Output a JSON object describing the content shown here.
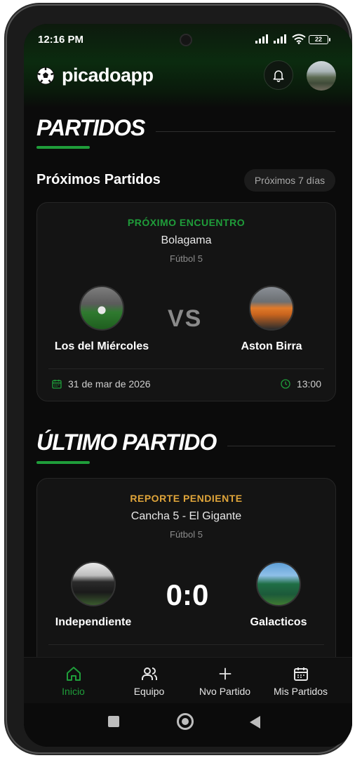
{
  "status_bar": {
    "time": "12:16 PM",
    "battery": "22"
  },
  "app": {
    "title": "picadoapp"
  },
  "colors": {
    "accent": "#1f9d3a",
    "pending": "#e0a53a",
    "background": "#0b0b0b",
    "card": "#141414"
  },
  "partidos": {
    "heading": "PARTIDOS",
    "subheading": "Próximos Partidos",
    "filter_chip": "Próximos 7 días",
    "next_match": {
      "label": "PRÓXIMO ENCUENTRO",
      "venue": "Bolagama",
      "type": "Fútbol 5",
      "home_team": "Los del Miércoles",
      "away_team": "Aston Birra",
      "vs_text": "VS",
      "date": "31 de mar de 2026",
      "time": "13:00"
    }
  },
  "ultimo": {
    "heading": "ÚLTIMO PARTIDO",
    "last_match": {
      "label": "REPORTE PENDIENTE",
      "venue": "Cancha 5 - El Gigante",
      "type": "Fútbol 5",
      "home_team": "Independiente",
      "away_team": "Galacticos",
      "score": "0:0"
    }
  },
  "bottom_nav": {
    "items": [
      {
        "label": "Inicio",
        "icon": "home-icon"
      },
      {
        "label": "Equipo",
        "icon": "users-icon"
      },
      {
        "label": "Nvo Partido",
        "icon": "plus-icon"
      },
      {
        "label": "Mis Partidos",
        "icon": "calendar-icon"
      }
    ]
  }
}
